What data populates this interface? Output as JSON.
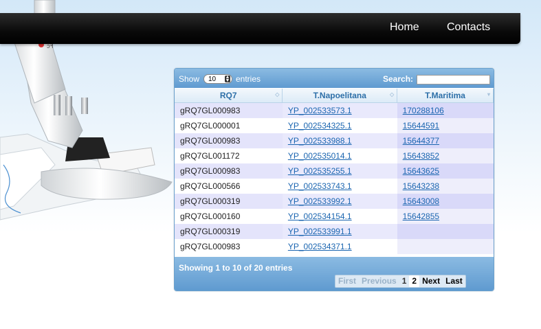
{
  "nav": {
    "home": "Home",
    "contacts": "Contacts"
  },
  "toolbar": {
    "show": "Show",
    "length_value": "10",
    "entries": "entries",
    "search_label": "Search:",
    "search_value": ""
  },
  "table": {
    "headers": [
      "RQ7",
      "T.Napoelitana",
      "T.Maritima"
    ],
    "rows": [
      [
        "gRQ7GL000983",
        "YP_002533573.1",
        "170288106"
      ],
      [
        "gRQ7GL000001",
        "YP_002534325.1",
        "15644591"
      ],
      [
        "gRQ7GL000983",
        "YP_002533988.1",
        "15644377"
      ],
      [
        "gRQ7GL001172",
        "YP_002535014.1",
        "15643852"
      ],
      [
        "gRQ7GL000983",
        "YP_002535255.1",
        "15643625"
      ],
      [
        "gRQ7GL000566",
        "YP_002533743.1",
        "15643238"
      ],
      [
        "gRQ7GL000319",
        "YP_002533992.1",
        "15643008"
      ],
      [
        "gRQ7GL000160",
        "YP_002534154.1",
        "15642855"
      ],
      [
        "gRQ7GL000319",
        "YP_002533991.1",
        ""
      ],
      [
        "gRQ7GL000983",
        "YP_002534371.1",
        ""
      ]
    ]
  },
  "footer": {
    "info": "Showing 1 to 10 of 20 entries",
    "first": "First",
    "previous": "Previous",
    "page1": "1",
    "page2": "2",
    "next": "Next",
    "last": "Last"
  },
  "icons": {
    "sort": "sort-arrows-icon",
    "select_arrows": "select-arrows-icon"
  },
  "colors": {
    "link": "#1a65b0",
    "header_text": "#2d6fa8",
    "bar": "#6ea8d8"
  }
}
